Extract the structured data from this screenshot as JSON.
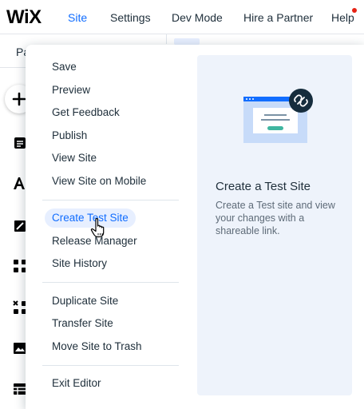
{
  "topbar": {
    "logo": "WiX",
    "nav": [
      {
        "label": "Site"
      },
      {
        "label": "Settings"
      },
      {
        "label": "Dev Mode"
      },
      {
        "label": "Hire a Partner"
      },
      {
        "label": "Help"
      }
    ],
    "accent": "#116dff",
    "help_notification_color": "#e62214"
  },
  "subbar": {
    "text": "Pa"
  },
  "leftrail": {
    "icons": [
      "plus-icon",
      "pages-icon",
      "text-theme-icon",
      "edit-icon",
      "apps-icon",
      "add-apps-icon",
      "media-icon",
      "table-icon"
    ]
  },
  "menu": {
    "groups": [
      [
        {
          "label": "Save"
        },
        {
          "label": "Preview"
        },
        {
          "label": "Get Feedback"
        },
        {
          "label": "Publish"
        },
        {
          "label": "View Site"
        },
        {
          "label": "View Site on Mobile"
        }
      ],
      [
        {
          "label": "Create Test Site"
        },
        {
          "label": "Release Manager"
        },
        {
          "label": "Site History"
        }
      ],
      [
        {
          "label": "Duplicate Site"
        },
        {
          "label": "Transfer Site"
        },
        {
          "label": "Move Site to Trash"
        }
      ],
      [
        {
          "label": "Exit Editor"
        }
      ]
    ],
    "highlighted": "Create Test Site"
  },
  "preview": {
    "title": "Create a Test Site",
    "description": "Create a Test site and view your changes with a shareable link."
  }
}
